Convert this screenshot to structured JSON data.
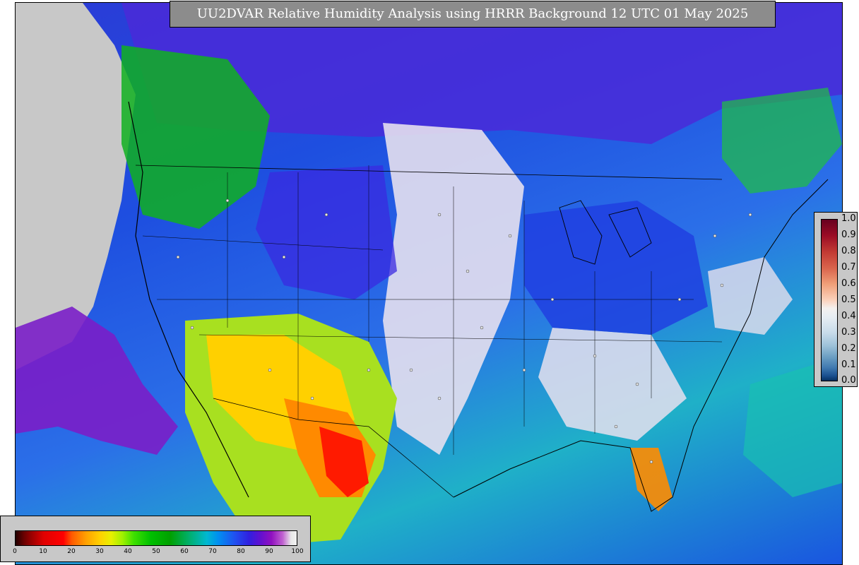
{
  "map": {
    "title": "UU2DVAR Relative Humidity Analysis using HRRR Background 12 UTC 01 May 2025"
  },
  "colorbar_vertical": {
    "ticks": [
      "1.0",
      "0.9",
      "0.8",
      "0.7",
      "0.6",
      "0.5",
      "0.4",
      "0.3",
      "0.2",
      "0.1",
      "0.0"
    ],
    "range": [
      0.0,
      1.0
    ]
  },
  "colorbar_horizontal": {
    "ticks": [
      "0",
      "10",
      "20",
      "30",
      "40",
      "50",
      "60",
      "70",
      "80",
      "90",
      "100"
    ],
    "range": [
      0,
      100
    ]
  },
  "colors": {
    "title_background": "#8c8c8c",
    "colorbar_background": "#c8c8c8",
    "no_data": "#c8c8c8",
    "dry": "#ff0000",
    "moist": "#2040e0"
  }
}
